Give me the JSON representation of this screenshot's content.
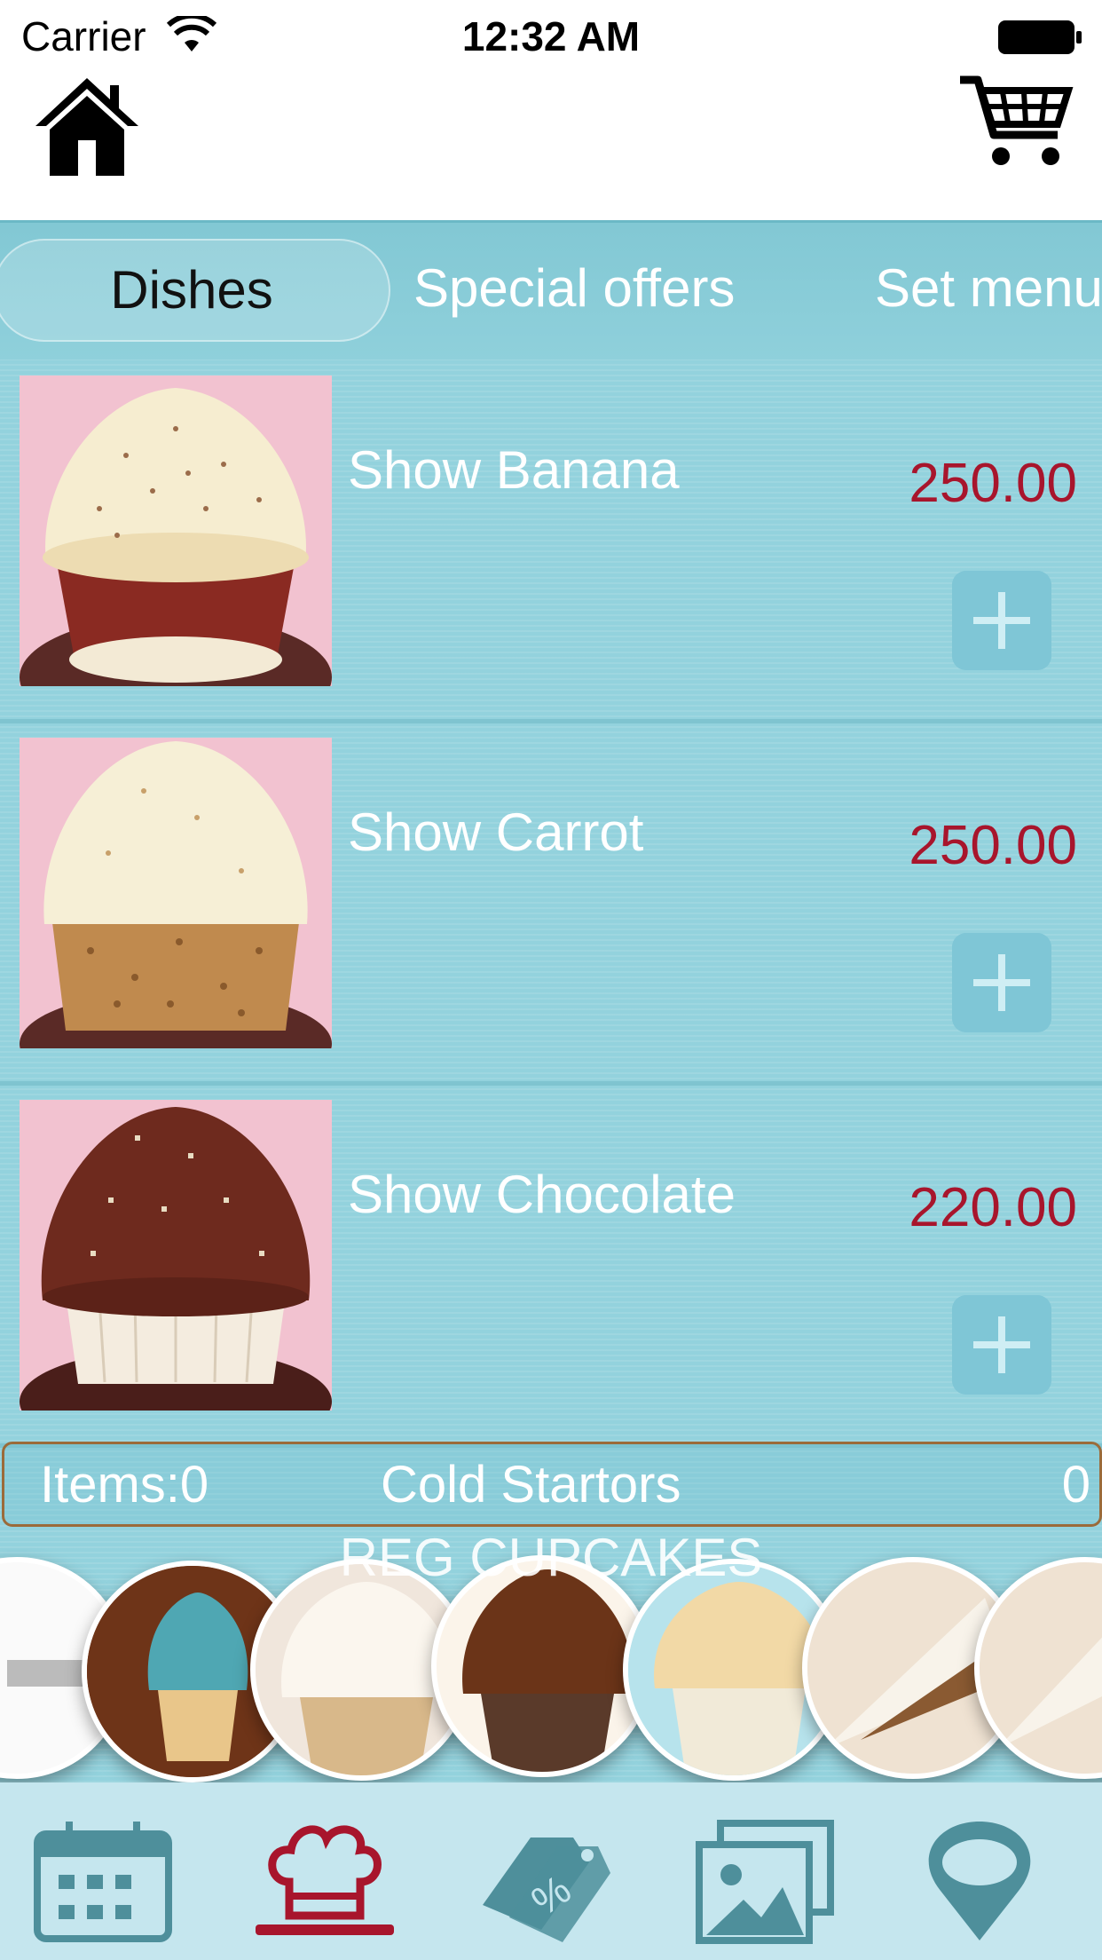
{
  "status_bar": {
    "carrier": "Carrier",
    "time": "12:32 AM"
  },
  "nav": {
    "home_icon": "home-icon",
    "cart_icon": "cart-icon"
  },
  "tabs": [
    {
      "label": "Dishes",
      "selected": true
    },
    {
      "label": "Special offers",
      "selected": false
    },
    {
      "label": "Set menu",
      "selected": false
    }
  ],
  "items": [
    {
      "name": "Show Banana",
      "price": "250.00",
      "image": "vanilla cupcake with red velvet base",
      "add_icon": "plus-icon"
    },
    {
      "name": "Show Carrot",
      "price": "250.00",
      "image": "cream cupcake with crumb coating",
      "add_icon": "plus-icon"
    },
    {
      "name": "Show Chocolate",
      "price": "220.00",
      "image": "chocolate frosted cupcake",
      "add_icon": "plus-icon"
    }
  ],
  "summary": {
    "items_label": "Items:0",
    "category": "Cold Startors",
    "count": "0"
  },
  "carousel": {
    "title": "REG CUPCAKES"
  },
  "tab_bar": [
    {
      "icon": "calendar-icon"
    },
    {
      "icon": "chef-hat-icon",
      "active": true
    },
    {
      "icon": "discount-tag-icon"
    },
    {
      "icon": "gallery-icon"
    },
    {
      "icon": "location-pin-icon"
    }
  ],
  "colors": {
    "accent_blue": "#93d2dd",
    "price_red": "#a8152c",
    "tab_icon": "#4e8f9b",
    "active_tab_icon": "#a8152c"
  }
}
